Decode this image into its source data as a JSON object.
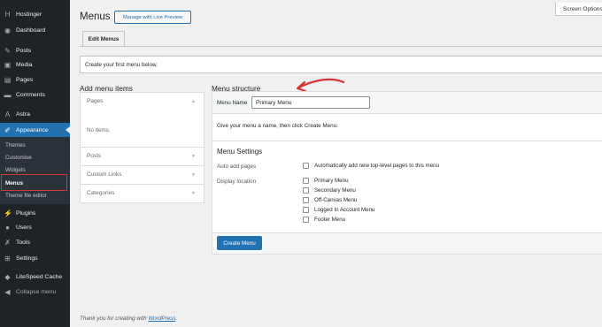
{
  "sidebar": {
    "items": [
      {
        "label": "Hostinger",
        "icon": "hostinger-icon"
      },
      {
        "label": "Dashboard",
        "icon": "dashboard-icon"
      },
      {
        "label": "Posts",
        "icon": "pin-icon"
      },
      {
        "label": "Media",
        "icon": "media-icon"
      },
      {
        "label": "Pages",
        "icon": "page-icon"
      },
      {
        "label": "Comments",
        "icon": "comment-icon"
      },
      {
        "label": "Astra",
        "icon": "astra-icon"
      },
      {
        "label": "Appearance",
        "icon": "brush-icon"
      },
      {
        "label": "Plugins",
        "icon": "plugin-icon"
      },
      {
        "label": "Users",
        "icon": "user-icon"
      },
      {
        "label": "Tools",
        "icon": "wrench-icon"
      },
      {
        "label": "Settings",
        "icon": "settings-icon"
      },
      {
        "label": "LiteSpeed Cache",
        "icon": "litespeed-icon"
      },
      {
        "label": "Collapse menu",
        "icon": "collapse-icon"
      }
    ],
    "submenu": [
      "Themes",
      "Customise",
      "Widgets",
      "Menus",
      "Theme file editor"
    ]
  },
  "header": {
    "screen_options": "Screen Options",
    "title": "Menus",
    "live_preview_button": "Manage with Live Preview",
    "tab": "Edit Menus",
    "notice": "Create your first menu below."
  },
  "add_items": {
    "title": "Add menu items",
    "sections": [
      "Pages",
      "Posts",
      "Custom Links",
      "Categories"
    ],
    "empty_text": "No items."
  },
  "structure": {
    "title": "Menu structure",
    "name_label": "Menu Name",
    "name_value": "Primary Menu",
    "hint": "Give your menu a name, then click Create Menu.",
    "settings_title": "Menu Settings",
    "auto_add_label": "Auto add pages",
    "auto_add_option": "Automatically add new top-level pages to this menu",
    "display_location_label": "Display location",
    "locations": [
      "Primary Menu",
      "Secondary Menu",
      "Off-Canvas Menu",
      "Logged In Account Menu",
      "Footer Menu"
    ],
    "create_button": "Create Menu"
  },
  "footer": {
    "text": "Thank you for creating with ",
    "link": "WordPress",
    "suffix": "."
  },
  "colors": {
    "sidebar_bg": "#1d2327",
    "accent": "#2271b1",
    "highlight": "#d63638"
  }
}
